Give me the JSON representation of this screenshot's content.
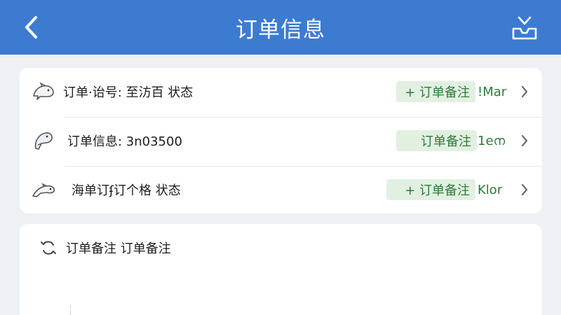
{
  "header": {
    "title": "订单信息",
    "back_icon": "chevron-left-icon",
    "share_icon": "inbox-download-icon"
  },
  "order_rows": [
    {
      "icon": "dolphin-icon",
      "label": "订单·诒号: 至汸百 状态",
      "tag": "+ 订单备注",
      "value": "!Mar"
    },
    {
      "icon": "dolphin-icon",
      "label": "订单信息: 3n03500",
      "tag": "订单备注",
      "value": "1eന"
    },
    {
      "icon": "dolphin-icon",
      "label": "海单订ʄ订个格 状态",
      "tag": "+ 订单备注",
      "value": "Klor"
    }
  ],
  "note": {
    "icon": "refresh-icon",
    "label": "订单备注 订单备注"
  },
  "colors": {
    "header_bg": "#3d7bd0",
    "tag_bg": "#e2f0e2",
    "tag_text": "#2c7a3a",
    "page_bg": "#eef0f3"
  }
}
